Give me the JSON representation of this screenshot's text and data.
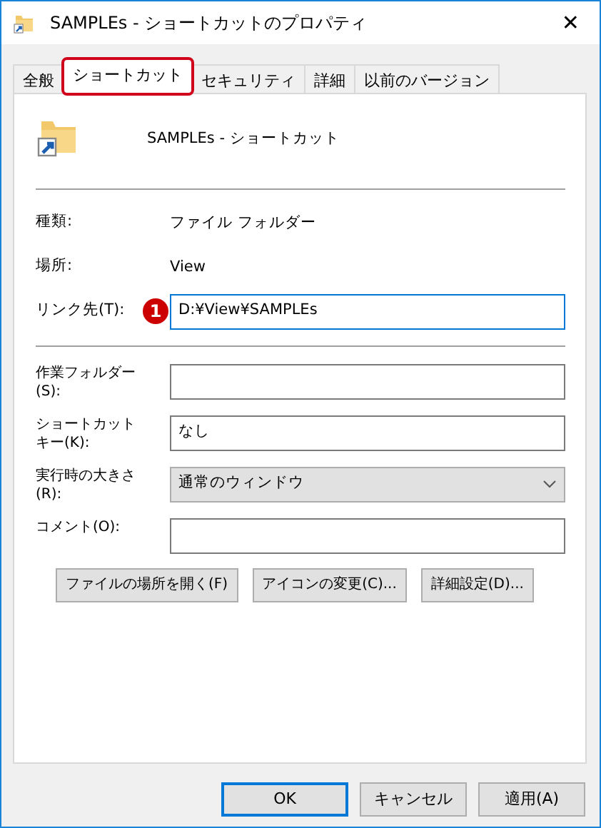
{
  "window": {
    "title": "SAMPLEs - ショートカットのプロパティ",
    "close": "✕"
  },
  "tabs": [
    {
      "label": "全般",
      "selected": false,
      "highlighted": false
    },
    {
      "label": "ショートカット",
      "selected": true,
      "highlighted": true
    },
    {
      "label": "セキュリティ",
      "selected": false,
      "highlighted": false
    },
    {
      "label": "詳細",
      "selected": false,
      "highlighted": false
    },
    {
      "label": "以前のバージョン",
      "selected": false,
      "highlighted": false
    }
  ],
  "header": {
    "name": "SAMPLEs - ショートカット"
  },
  "info": [
    {
      "label": "種類:",
      "value": "ファイル フォルダー"
    },
    {
      "label": "場所:",
      "value": "View"
    }
  ],
  "link": {
    "label": "リンク先(T):",
    "value": "D:¥View¥SAMPLEs",
    "focused": true,
    "callout": "1"
  },
  "fields": [
    {
      "kind": "text",
      "label": "作業フォルダー(S):"
    },
    {
      "kind": "text",
      "label": "ショートカットキー(K):",
      "value": "なし"
    },
    {
      "kind": "select",
      "label": "実行時の大きさ(R):",
      "value": "通常のウィンドウ"
    },
    {
      "kind": "text",
      "label": "コメント(O):"
    }
  ],
  "actions": [
    "ファイルの場所を開く(F)",
    "アイコンの変更(C)...",
    "詳細設定(D)..."
  ],
  "buttons": [
    {
      "label": "OK",
      "default": true
    },
    {
      "label": "キャンセル",
      "default": false
    },
    {
      "label": "適用(A)",
      "default": false
    }
  ]
}
